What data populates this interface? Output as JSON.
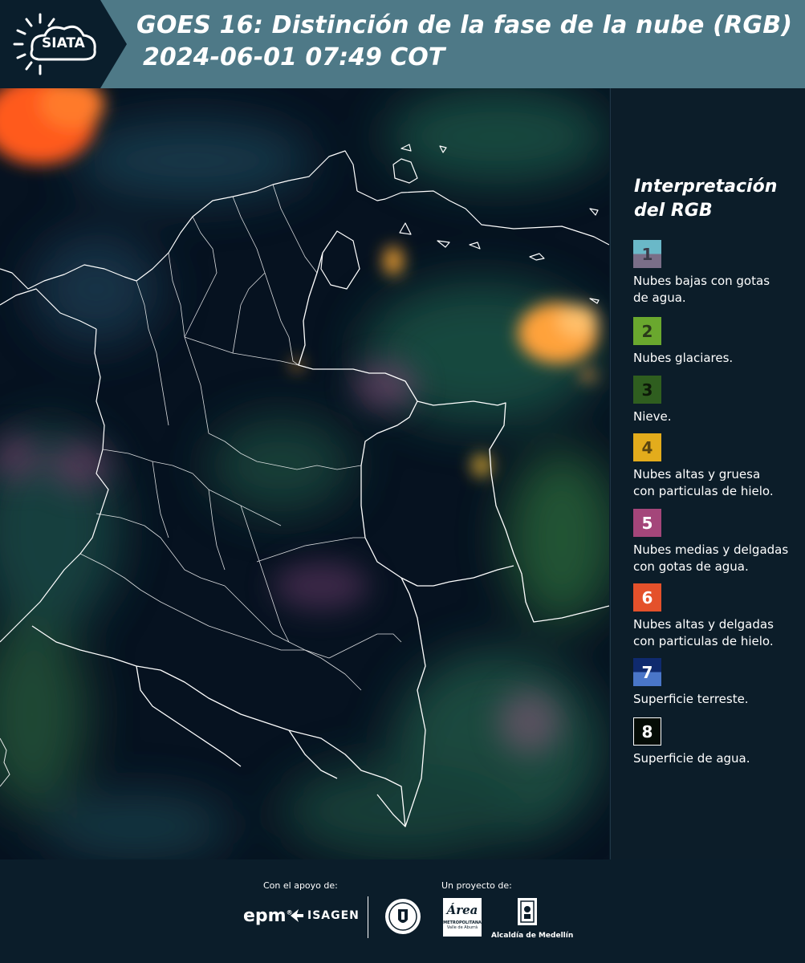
{
  "header": {
    "logo_text": "SIATA",
    "title_line1": "GOES 16: Distinción de la fase de la nube (RGB)",
    "title_line2": "2024-06-01 07:49 COT"
  },
  "legend": {
    "title_line1": "Interpretación",
    "title_line2": "del RGB",
    "items": [
      {
        "num": "1",
        "label": "Nubes bajas con gotas de agua.",
        "top_color": "#6ab8c8",
        "bottom_color": "#7a6e88",
        "num_color": "#3a3a48"
      },
      {
        "num": "2",
        "label": "Nubes glaciares.",
        "top_color": "#6aa82e",
        "bottom_color": "#6aa82e",
        "num_color": "#2a3a1a"
      },
      {
        "num": "3",
        "label": "Nieve.",
        "top_color": "#2f5e1f",
        "bottom_color": "#2f5e1f",
        "num_color": "#0d1a08"
      },
      {
        "num": "4",
        "label": "Nubes altas y gruesa con particulas de hielo.",
        "top_color": "#e3ac1c",
        "bottom_color": "#e3ac1c",
        "num_color": "#5a4510"
      },
      {
        "num": "5",
        "label": "Nubes medias y delgadas con gotas de agua.",
        "top_color": "#a4467a",
        "bottom_color": "#a4467a",
        "num_color": "#ffffff"
      },
      {
        "num": "6",
        "label": "Nubes altas y delgadas con particulas de hielo.",
        "top_color": "#e4512b",
        "bottom_color": "#e4512b",
        "num_color": "#ffffff"
      },
      {
        "num": "7",
        "label": "Superficie terreste.",
        "top_color": "#0f2a6e",
        "bottom_color": "#4a76c8",
        "num_color": "#ffffff"
      },
      {
        "num": "8",
        "label": "Superficie de agua.",
        "top_color": "#050c06",
        "bottom_color": "#050c06",
        "num_color": "#ffffff"
      }
    ]
  },
  "footer": {
    "support_caption": "Con el apoyo de:",
    "project_caption": "Un proyecto de:",
    "logo_epm": "epm",
    "logo_isagen": "ISAGEN",
    "logo_area": "Área",
    "logo_area_sub1": "METROPOLITANA",
    "logo_area_sub2": "Valle de Aburrá",
    "logo_alcaldia": "Alcaldía de Medellín"
  }
}
